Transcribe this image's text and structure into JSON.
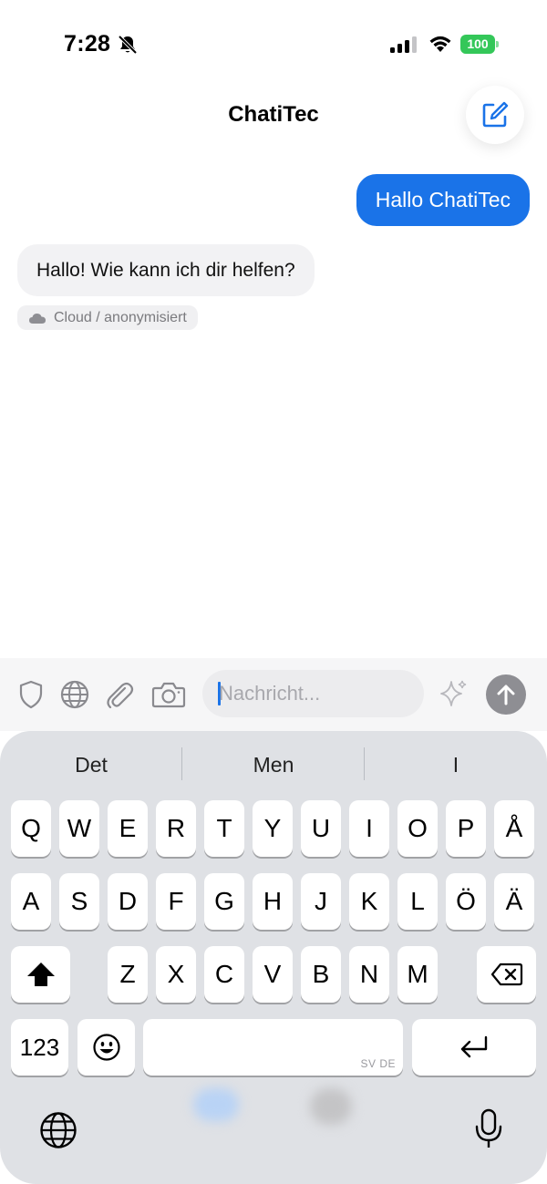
{
  "status_bar": {
    "time": "7:28",
    "battery": "100",
    "icons": [
      "bell-slash-icon",
      "signal-icon",
      "wifi-icon",
      "battery-icon"
    ]
  },
  "header": {
    "title": "ChatiTec",
    "compose_icon": "compose-icon"
  },
  "messages": [
    {
      "role": "user",
      "text": "Hallo ChatiTec"
    },
    {
      "role": "assistant",
      "text": "Hallo! Wie kann ich dir helfen?",
      "tag": "Cloud / anonymisiert",
      "tag_icon": "cloud-icon"
    }
  ],
  "input_bar": {
    "icons": [
      "shield-icon",
      "globe-icon",
      "paperclip-icon",
      "camera-icon",
      "sparkle-icon",
      "send-arrow-icon"
    ],
    "placeholder": "Nachricht..."
  },
  "keyboard": {
    "suggestions": [
      "Det",
      "Men",
      "I"
    ],
    "rows": [
      [
        "Q",
        "W",
        "E",
        "R",
        "T",
        "Y",
        "U",
        "I",
        "O",
        "P",
        "Å"
      ],
      [
        "A",
        "S",
        "D",
        "F",
        "G",
        "H",
        "J",
        "K",
        "L",
        "Ö",
        "Ä"
      ],
      [
        "Z",
        "X",
        "C",
        "V",
        "B",
        "N",
        "M"
      ]
    ],
    "numbers_label": "123",
    "space_lang": "SV DE",
    "icons": [
      "shift-icon",
      "backspace-icon",
      "emoji-icon",
      "return-icon",
      "globe-icon",
      "microphone-icon"
    ]
  },
  "colors": {
    "accent": "#1a73e8",
    "battery": "#34c759",
    "keyboard_bg": "#dfe1e5"
  }
}
